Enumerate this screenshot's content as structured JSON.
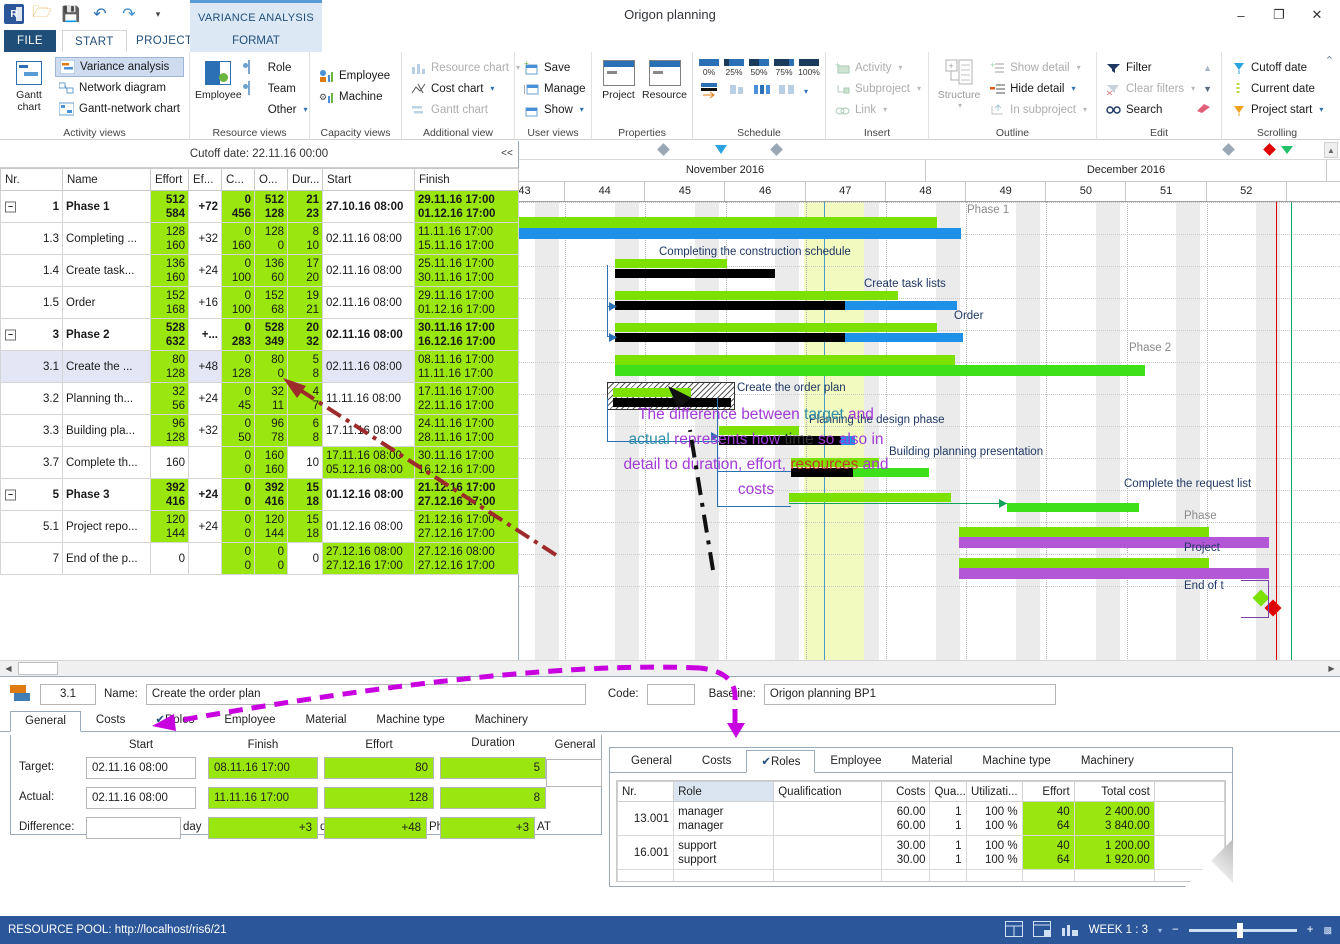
{
  "window": {
    "title": "Origon planning",
    "minimize": "–",
    "maximize": "❐",
    "close": "✕"
  },
  "context_tab": {
    "label": "VARIANCE ANALYSIS",
    "sub": "FORMAT"
  },
  "tabs": [
    {
      "label": "FILE"
    },
    {
      "label": "START"
    },
    {
      "label": "PROJECT"
    }
  ],
  "ribbon": {
    "groups": [
      {
        "name": "Activity views",
        "big": [
          {
            "label": "Gantt chart",
            "icon": "gantt-chart-icon"
          }
        ],
        "items": [
          {
            "label": "Variance analysis",
            "icon": "variance-analysis-icon",
            "selected": true
          },
          {
            "label": "Network diagram",
            "icon": "network-diagram-icon"
          },
          {
            "label": "Gantt-network chart",
            "icon": "gantt-network-icon"
          }
        ]
      },
      {
        "name": "Resource views",
        "big": [
          {
            "label": "Employee",
            "icon": "employee-icon"
          }
        ],
        "items": [
          {
            "label": "Role",
            "icon": "role-icon"
          },
          {
            "label": "Team",
            "icon": "team-icon"
          },
          {
            "label": "Other",
            "icon": "other-icon",
            "dropdown": true
          }
        ]
      },
      {
        "name": "Capacity views",
        "items": [
          {
            "label": "Employee",
            "icon": "employee-bars-icon"
          },
          {
            "label": "Machine",
            "icon": "machine-bars-icon"
          }
        ]
      },
      {
        "name": "Additional view",
        "items": [
          {
            "label": "Resource chart",
            "icon": "resource-chart-icon",
            "disabled": true,
            "dropdown": true
          },
          {
            "label": "Cost chart",
            "icon": "cost-chart-icon",
            "dropdown": true
          },
          {
            "label": "Gantt chart",
            "icon": "gantt-small-icon",
            "disabled": true
          }
        ]
      },
      {
        "name": "User views",
        "items": [
          {
            "label": "Save",
            "icon": "save-view-icon"
          },
          {
            "label": "Manage",
            "icon": "manage-view-icon"
          },
          {
            "label": "Show",
            "icon": "show-view-icon",
            "dropdown": true
          }
        ]
      },
      {
        "name": "Properties",
        "big": [
          {
            "label": "Project",
            "icon": "project-properties-icon"
          },
          {
            "label": "Resource",
            "icon": "resource-properties-icon"
          }
        ]
      },
      {
        "name": "Schedule",
        "percents": [
          "0%",
          "25%",
          "50%",
          "75%",
          "100%"
        ]
      },
      {
        "name": "Insert",
        "items": [
          {
            "label": "Activity",
            "icon": "add-activity-icon",
            "disabled": true,
            "dropdown": true
          },
          {
            "label": "Subproject",
            "icon": "add-subproject-icon",
            "disabled": true,
            "dropdown": true
          },
          {
            "label": "Link",
            "icon": "link-icon",
            "disabled": true,
            "dropdown": true
          }
        ]
      },
      {
        "name": "Outline",
        "big": [
          {
            "label": "Structure",
            "icon": "structure-icon",
            "dropdown": true
          }
        ],
        "items": [
          {
            "label": "Show detail",
            "icon": "show-detail-icon",
            "disabled": true,
            "dropdown": true
          },
          {
            "label": "Hide detail",
            "icon": "hide-detail-icon",
            "dropdown": true
          },
          {
            "label": "In subproject",
            "icon": "in-subproject-icon",
            "disabled": true,
            "dropdown": true
          }
        ]
      },
      {
        "name": "Edit",
        "items": [
          {
            "label": "Filter",
            "icon": "filter-icon"
          },
          {
            "label": "Clear filters",
            "icon": "clear-filters-icon",
            "disabled": true,
            "dropdown": true
          },
          {
            "label": "Search",
            "icon": "search-icon"
          }
        ],
        "extra": [
          {
            "label": "",
            "icon": "scroll-up-icon"
          },
          {
            "label": "",
            "icon": "scroll-down-icon"
          },
          {
            "label": "",
            "icon": "eraser-icon"
          }
        ]
      },
      {
        "name": "Scrolling",
        "items": [
          {
            "label": "Cutoff date",
            "icon": "cutoff-date-icon"
          },
          {
            "label": "Current date",
            "icon": "current-date-icon"
          },
          {
            "label": "Project start",
            "icon": "project-start-icon",
            "dropdown": true
          }
        ]
      }
    ],
    "collapse_ribbon": "⌃"
  },
  "grid": {
    "cutoff_label": "Cutoff date: 22.11.16 00:00",
    "collapse_button": "<<",
    "columns": [
      "Nr.",
      "Name",
      "Effort",
      "Ef...",
      "C...",
      "O...",
      "Dur...",
      "Start",
      "Finish"
    ],
    "rows": [
      {
        "nr": "1",
        "expander": "−",
        "name": "Phase 1",
        "bold": true,
        "effort": [
          "512",
          "584"
        ],
        "diff": "+72",
        "c": [
          "0",
          "456"
        ],
        "o": [
          "512",
          "128"
        ],
        "dur": [
          "21",
          "23"
        ],
        "start": [
          "27.10.16 08:00"
        ],
        "finish": [
          "29.11.16 17:00",
          "01.12.16 17:00"
        ],
        "start_green": false,
        "selected": false
      },
      {
        "nr": "1.3",
        "name": "Completing ...",
        "effort": [
          "128",
          "160"
        ],
        "diff": "+32",
        "c": [
          "0",
          "160"
        ],
        "o": [
          "128",
          "0"
        ],
        "dur": [
          "8",
          "10"
        ],
        "start": [
          "02.11.16 08:00"
        ],
        "finish": [
          "11.11.16 17:00",
          "15.11.16 17:00"
        ],
        "start_green": false,
        "selected": false
      },
      {
        "nr": "1.4",
        "name": "Create task...",
        "effort": [
          "136",
          "160"
        ],
        "diff": "+24",
        "c": [
          "0",
          "100"
        ],
        "o": [
          "136",
          "60"
        ],
        "dur": [
          "17",
          "20"
        ],
        "start": [
          "02.11.16 08:00"
        ],
        "finish": [
          "25.11.16 17:00",
          "30.11.16 17:00"
        ],
        "start_green": false,
        "selected": false
      },
      {
        "nr": "1.5",
        "name": "Order",
        "effort": [
          "152",
          "168"
        ],
        "diff": "+16",
        "c": [
          "0",
          "100"
        ],
        "o": [
          "152",
          "68"
        ],
        "dur": [
          "19",
          "21"
        ],
        "start": [
          "02.11.16 08:00"
        ],
        "finish": [
          "29.11.16 17:00",
          "01.12.16 17:00"
        ],
        "start_green": false,
        "selected": false
      },
      {
        "nr": "3",
        "expander": "−",
        "name": "Phase 2",
        "bold": true,
        "effort": [
          "528",
          "632"
        ],
        "diff": "+...",
        "c": [
          "0",
          "283"
        ],
        "o": [
          "528",
          "349"
        ],
        "dur": [
          "20",
          "32"
        ],
        "start": [
          "02.11.16 08:00"
        ],
        "finish": [
          "30.11.16 17:00",
          "16.12.16 17:00"
        ],
        "start_green": false,
        "selected": false
      },
      {
        "nr": "3.1",
        "name": "Create the ...",
        "effort": [
          "80",
          "128"
        ],
        "diff": "+48",
        "c": [
          "0",
          "128"
        ],
        "o": [
          "80",
          "0"
        ],
        "dur": [
          "5",
          "8"
        ],
        "start": [
          "02.11.16 08:00"
        ],
        "finish": [
          "08.11.16 17:00",
          "11.11.16 17:00"
        ],
        "start_green": false,
        "selected": true
      },
      {
        "nr": "3.2",
        "name": "Planning th...",
        "effort": [
          "32",
          "56"
        ],
        "diff": "+24",
        "c": [
          "0",
          "45"
        ],
        "o": [
          "32",
          "11"
        ],
        "dur": [
          "4",
          "7"
        ],
        "start": [
          "11.11.16 08:00"
        ],
        "finish": [
          "17.11.16 17:00",
          "22.11.16 17:00"
        ],
        "start_green": false,
        "selected": false
      },
      {
        "nr": "3.3",
        "name": "Building pla...",
        "effort": [
          "96",
          "128"
        ],
        "diff": "+32",
        "c": [
          "0",
          "50"
        ],
        "o": [
          "96",
          "78"
        ],
        "dur": [
          "6",
          "8"
        ],
        "start": [
          "17.11.16 08:00"
        ],
        "finish": [
          "24.11.16 17:00",
          "28.11.16 17:00"
        ],
        "start_green": false,
        "selected": false
      },
      {
        "nr": "3.7",
        "name": "Complete th...",
        "effort": [
          "160"
        ],
        "diff": "",
        "c": [
          "0",
          "0"
        ],
        "o": [
          "160",
          "160"
        ],
        "dur": [
          "10"
        ],
        "start": [
          "17.11.16 08:00",
          "05.12.16 08:00"
        ],
        "finish": [
          "30.11.16 17:00",
          "16.12.16 17:00"
        ],
        "effort_green": false,
        "start_green": true,
        "selected": false
      },
      {
        "nr": "5",
        "expander": "−",
        "name": "Phase 3",
        "bold": true,
        "effort": [
          "392",
          "416"
        ],
        "diff": "+24",
        "c": [
          "0",
          "0"
        ],
        "o": [
          "392",
          "416"
        ],
        "dur": [
          "15",
          "18"
        ],
        "start": [
          "01.12.16 08:00"
        ],
        "finish": [
          "21.12.16 17:00",
          "27.12.16 17:00"
        ],
        "start_green": false,
        "selected": false
      },
      {
        "nr": "5.1",
        "name": "Project repo...",
        "effort": [
          "120",
          "144"
        ],
        "diff": "+24",
        "c": [
          "0",
          "0"
        ],
        "o": [
          "120",
          "144"
        ],
        "dur": [
          "15",
          "18"
        ],
        "start": [
          "01.12.16 08:00"
        ],
        "finish": [
          "21.12.16 17:00",
          "27.12.16 17:00"
        ],
        "start_green": false,
        "selected": false
      },
      {
        "nr": "7",
        "name": "End of the p...",
        "effort": [
          "0"
        ],
        "diff": "",
        "c": [
          "0",
          "0"
        ],
        "o": [
          "0",
          "0"
        ],
        "dur": [
          "0"
        ],
        "start": [
          "27.12.16 08:00",
          "27.12.16 17:00"
        ],
        "finish": [
          "27.12.16 08:00",
          "27.12.16 17:00"
        ],
        "effort_green": false,
        "start_green": true,
        "selected": false
      }
    ]
  },
  "gantt": {
    "months": [
      "November 2016",
      "December 2016"
    ],
    "weeks": [
      "43",
      "44",
      "45",
      "46",
      "47",
      "48",
      "49",
      "50",
      "51",
      "52"
    ],
    "bar_labels": [
      "Phase 1",
      "Completing the construction schedule",
      "Create task lists",
      "Order",
      "Phase 2",
      "Create the order plan",
      "Planning the design phase",
      "Building planning presentation",
      "Complete the request list",
      "Phase",
      "Project",
      "End of t"
    ],
    "annotation": {
      "line1": "The difference between target and",
      "line2": "actual represents how time so also in",
      "line3": "detail to duration, effort, resources and",
      "line4": "costs"
    }
  },
  "detail": {
    "nr": "3.1",
    "name_label": "Name:",
    "name_value": "Create the order plan",
    "code_label": "Code:",
    "code_value": "",
    "baseline_label": "Baseline:",
    "baseline_value": "Origon planning BP1",
    "tabs": [
      "General",
      "Costs",
      "Roles",
      "Employee",
      "Material",
      "Machine type",
      "Machinery"
    ],
    "active_tab": "General",
    "checked_tab": "Roles",
    "columns": [
      "Start",
      "Finish",
      "Effort",
      "Duration"
    ],
    "section_label": "General",
    "rows": [
      {
        "label": "Target:",
        "start": "02.11.16 08:00",
        "finish": "08.11.16 17:00",
        "effort": "80",
        "duration": "5"
      },
      {
        "label": "Actual:",
        "start": "02.11.16 08:00",
        "finish": "11.11.16 17:00",
        "effort": "128",
        "duration": "8"
      },
      {
        "label": "Difference:",
        "start": "",
        "finish": "+3",
        "effort": "+48",
        "duration": "+3"
      }
    ],
    "units": {
      "start": "day",
      "finish": "day",
      "effort": "Ph",
      "duration": "AT"
    }
  },
  "roles_panel": {
    "tabs": [
      "General",
      "Costs",
      "Roles",
      "Employee",
      "Material",
      "Machine type",
      "Machinery"
    ],
    "active_tab": "Roles",
    "columns": [
      "Nr.",
      "Role",
      "Qualification",
      "Costs",
      "Qua...",
      "Utilizati...",
      "Effort",
      "Total cost"
    ],
    "rows": [
      {
        "nr": "13.001",
        "role": [
          "manager",
          "manager"
        ],
        "qualification": "",
        "costs": [
          "60.00",
          "60.00"
        ],
        "qty": [
          "1",
          "1"
        ],
        "util": [
          "100 %",
          "100 %"
        ],
        "effort": [
          "40",
          "64"
        ],
        "total": [
          "2 400.00",
          "3 840.00"
        ]
      },
      {
        "nr": "16.001",
        "role": [
          "support",
          "support"
        ],
        "qualification": "",
        "costs": [
          "30.00",
          "30.00"
        ],
        "qty": [
          "1",
          "1"
        ],
        "util": [
          "100 %",
          "100 %"
        ],
        "effort": [
          "40",
          "64"
        ],
        "total": [
          "1 200.00",
          "1 920.00"
        ]
      }
    ]
  },
  "status": {
    "resource_pool": "RESOURCE POOL: http://localhost/ris6/21",
    "zoom_label": "WEEK 1 : 3",
    "zoom_minus": "−",
    "zoom_plus": "+"
  },
  "colors": {
    "accent": "#2b579a",
    "green_cell": "#9ae60f",
    "bar_green": "#7ce000",
    "bar_blue": "#1e90e8",
    "bar_purple": "#b457d6",
    "annotation": "#a33bd6"
  }
}
